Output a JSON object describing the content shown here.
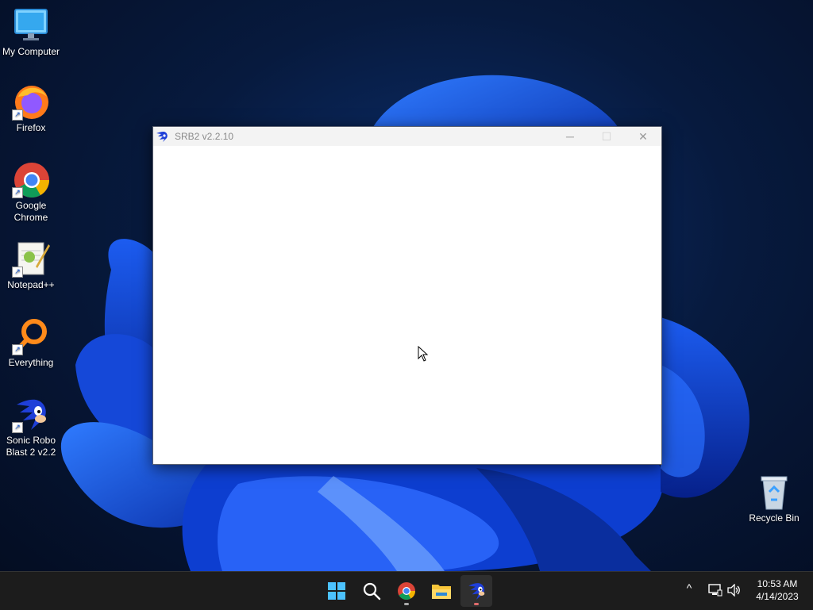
{
  "desktop": {
    "icons": [
      {
        "label": "My Computer",
        "icon": "monitor-icon"
      },
      {
        "label": "Firefox",
        "icon": "firefox-icon"
      },
      {
        "label": "Google Chrome",
        "icon": "chrome-icon"
      },
      {
        "label": "Notepad++",
        "icon": "notepadpp-icon"
      },
      {
        "label": "Everything",
        "icon": "everything-icon"
      },
      {
        "label": "Sonic Robo Blast 2 v2.2",
        "icon": "sonic-icon"
      }
    ],
    "recycle_bin": {
      "label": "Recycle Bin",
      "icon": "recycle-bin-icon"
    }
  },
  "window": {
    "title": "SRB2 v2.2.10",
    "controls": {
      "minimize": "─",
      "maximize": "☐",
      "close": "✕"
    }
  },
  "taskbar": {
    "buttons": [
      "start-icon",
      "search-icon",
      "chrome-icon",
      "file-explorer-icon",
      "sonic-icon"
    ],
    "tray": {
      "chevron": "^",
      "network": "network-icon",
      "volume": "volume-icon"
    },
    "clock": {
      "time": "10:53 AM",
      "date": "4/14/2023"
    }
  },
  "colors": {
    "accent": "#0a5fff",
    "taskbar": "#1c1c1c",
    "titlebar": "#f3f3f3"
  }
}
